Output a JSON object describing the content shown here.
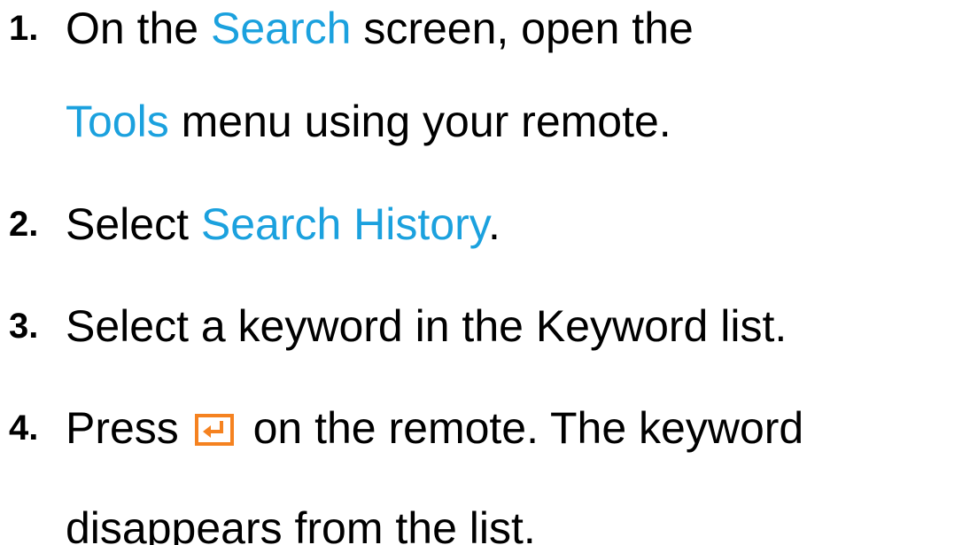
{
  "steps": [
    {
      "number": "1.",
      "line1": {
        "pre": "On the ",
        "highlight": "Search",
        "post": " screen, open the"
      },
      "line2": {
        "highlight": "Tools",
        "post": " menu using your remote."
      }
    },
    {
      "number": "2.",
      "pre": "Select ",
      "highlight": "Search History",
      "post": "."
    },
    {
      "number": "3.",
      "text": "Select a keyword in the Keyword list."
    },
    {
      "number": "4.",
      "line1": {
        "pre": "Press ",
        "icon": "enter-button-icon",
        "post": " on the remote. The keyword"
      },
      "line2": {
        "text": "disappears from the list."
      }
    }
  ],
  "colors": {
    "highlight": "#1ba1de",
    "icon": "#f58220",
    "text": "#000000",
    "background": "#ffffff"
  }
}
